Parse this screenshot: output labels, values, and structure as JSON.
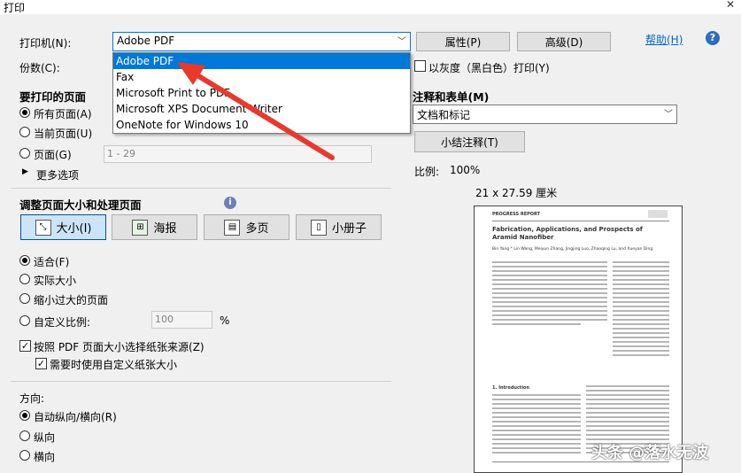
{
  "window": {
    "title": "打印",
    "close_glyph": "✕"
  },
  "printer": {
    "label": "打印机(N):",
    "selected": "Adobe PDF",
    "options": [
      "Adobe PDF",
      "Fax",
      "Microsoft Print to PDF",
      "Microsoft XPS Document Writer",
      "OneNote for Windows 10"
    ],
    "properties_button": "属性(P)",
    "advanced_button": "高级(D)",
    "help_link": "帮助(H)",
    "help_icon_glyph": "?"
  },
  "copies": {
    "label": "份数(C):"
  },
  "grayscale": {
    "label": "以灰度（黑白色）打印(Y)",
    "checked": false
  },
  "pages_section": {
    "heading": "要打印的页面",
    "all": "所有页面(A)",
    "current": "当前页面(U)",
    "pages": "页面(G)",
    "pages_range": "1 - 29",
    "more_options": "更多选项"
  },
  "comments_section": {
    "heading": "注释和表单(M)",
    "selected": "文档和标记",
    "summarize_button": "小结注释(T)"
  },
  "sizing_section": {
    "heading": "调整页面大小和处理页面",
    "info_glyph": "i",
    "buttons": [
      "大小(I)",
      "海报",
      "多页",
      "小册子"
    ],
    "fit": "适合(F)",
    "actual": "实际大小",
    "shrink": "缩小过大的页面",
    "custom": "自定义比例:",
    "custom_value": "100",
    "percent": "%",
    "choose_source": "按照 PDF 页面大小选择纸张来源(Z)",
    "use_custom_paper": "需要时使用自定义纸张大小"
  },
  "orientation_section": {
    "heading": "方向:",
    "auto": "自动纵向/横向(R)",
    "portrait": "纵向",
    "landscape": "横向"
  },
  "preview": {
    "scale_label": "比例:",
    "scale_value": "100%",
    "paper_size": "21 x 27.59 厘米",
    "doc_header": "PROGRESS REPORT",
    "doc_title": "Fabrication, Applications, and Prospects of Aramid Nanofiber",
    "doc_authors": "Bin Yang * Lin Wang, Meiyun Zhang, Jingjing Luo, Zhaoqing Lu, and Xueyan Ding",
    "intro_heading": "1. Introduction"
  },
  "watermark": "头条 @落水无波",
  "colors": {
    "accent": "#0078d7",
    "arrow": "#e8392e",
    "help_icon": "#2f6cbf"
  }
}
